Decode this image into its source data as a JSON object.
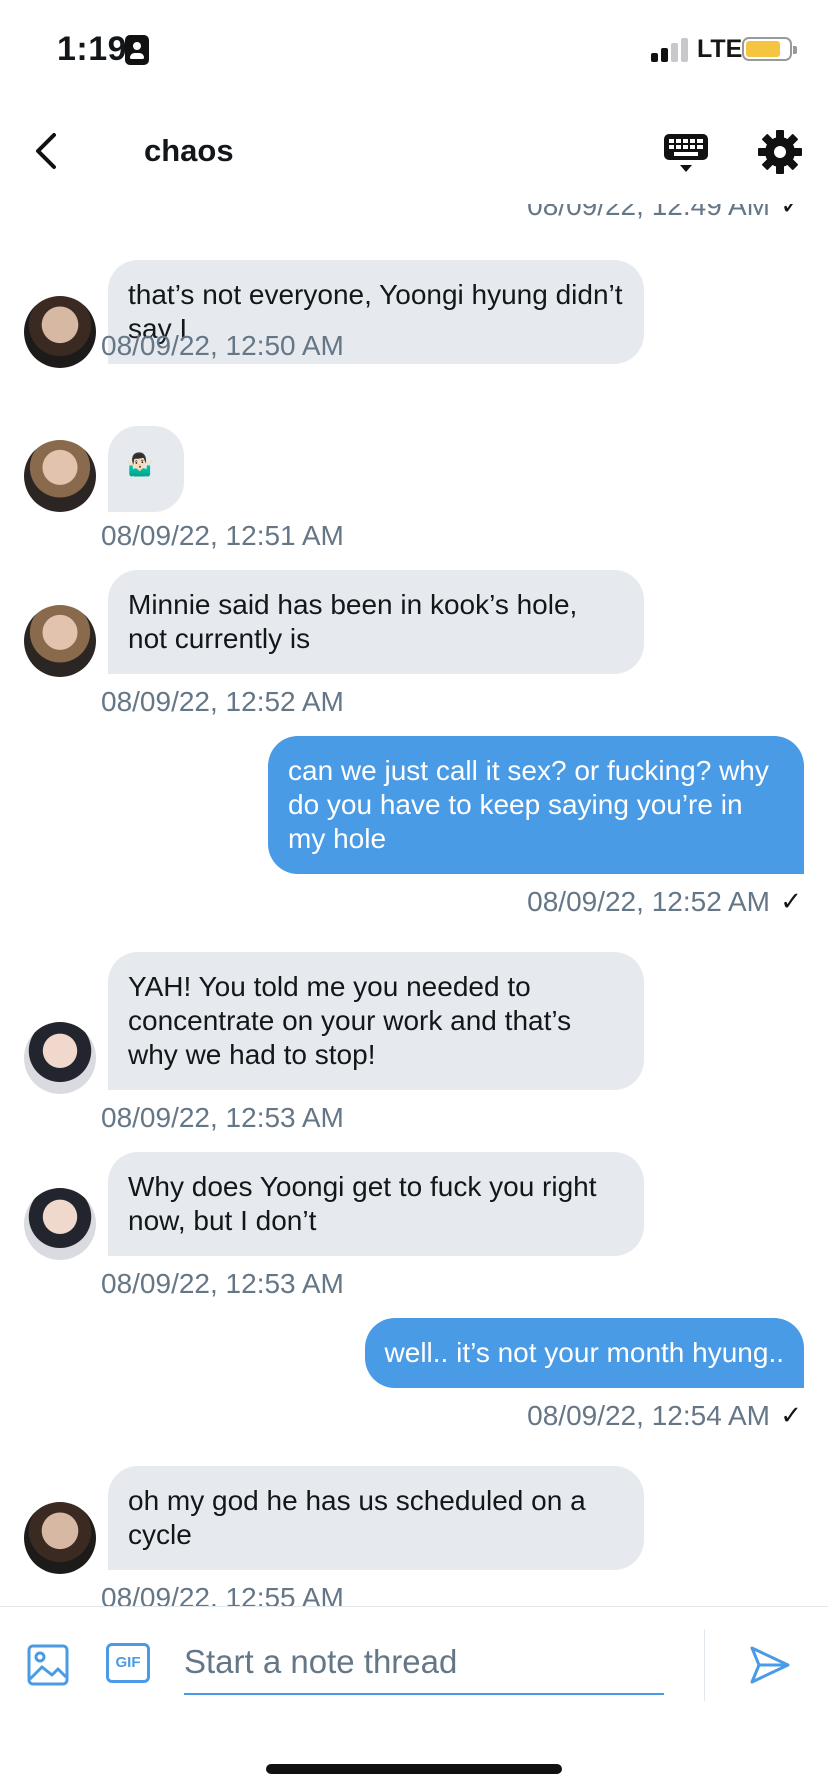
{
  "status_bar": {
    "time": "1:19",
    "network": "LTE"
  },
  "header": {
    "title": "chaos"
  },
  "top_partial_timestamp": "08/09/22, 12:49 AM",
  "messages": [
    {
      "direction": "in",
      "text": "that’s not everyone, Yoongi hyung didn’t say I",
      "timestamp": "08/09/22, 12:50 AM"
    },
    {
      "direction": "in",
      "text": "🤷🏻‍♂️",
      "timestamp": "08/09/22, 12:51 AM"
    },
    {
      "direction": "in",
      "text": "Minnie said has been in kook’s hole, not currently is",
      "timestamp": "08/09/22, 12:52 AM"
    },
    {
      "direction": "out",
      "text": "can we just call it sex? or fucking? why do you have to keep saying you’re in my hole",
      "timestamp": "08/09/22, 12:52 AM"
    },
    {
      "direction": "in",
      "text": "YAH! You told me you needed to concentrate on your work and that’s why we had to stop!",
      "timestamp": "08/09/22, 12:53 AM"
    },
    {
      "direction": "in",
      "text": "Why does Yoongi get to fuck you right now, but I don’t",
      "timestamp": "08/09/22, 12:53 AM"
    },
    {
      "direction": "out",
      "text": "well.. it’s not your month hyung..",
      "timestamp": "08/09/22, 12:54 AM"
    },
    {
      "direction": "in",
      "text": "oh my god he has us scheduled on a cycle",
      "timestamp": "08/09/22, 12:55 AM"
    }
  ],
  "compose": {
    "placeholder": "Start a note thread",
    "gif_label": "GIF"
  },
  "colors": {
    "accent": "#4a9be6",
    "incoming_bubble": "#e6e9ee",
    "timestamp": "#657786"
  }
}
